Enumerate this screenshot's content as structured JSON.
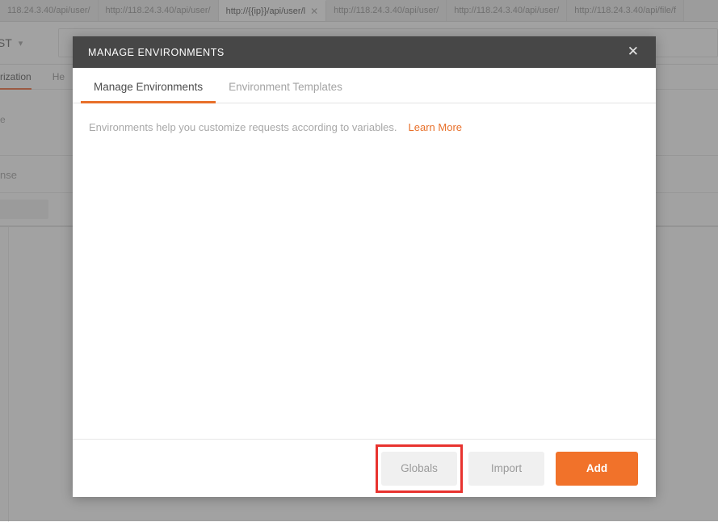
{
  "background": {
    "tabs": [
      {
        "label": "118.24.3.40/api/user/",
        "active": false,
        "closable": false
      },
      {
        "label": "http://118.24.3.40/api/user/",
        "active": false,
        "closable": false
      },
      {
        "label": "http://{{ip}}/api/user/l",
        "active": true,
        "closable": true,
        "close_icon": "close-icon"
      },
      {
        "label": "http://118.24.3.40/api/user/",
        "active": false,
        "closable": false
      },
      {
        "label": "http://118.24.3.40/api/user/",
        "active": false,
        "closable": false
      },
      {
        "label": "http://118.24.3.40/api/file/f",
        "active": false,
        "closable": false
      }
    ],
    "request": {
      "method": "OST",
      "method_caret_icon": "chevron-down-icon",
      "url_value": "",
      "url_placeholder": ""
    },
    "subtabs": [
      {
        "label": "rization",
        "selected": true
      },
      {
        "label": "He",
        "selected": false
      }
    ],
    "section_a_text": "e",
    "section_b_text": "nse"
  },
  "modal": {
    "title": "MANAGE ENVIRONMENTS",
    "close_icon": "close-icon",
    "tabs": [
      {
        "label": "Manage Environments",
        "active": true
      },
      {
        "label": "Environment Templates",
        "active": false
      }
    ],
    "body": {
      "description": "Environments help you customize requests according to variables.",
      "learn_more_label": "Learn More"
    },
    "footer": {
      "globals_label": "Globals",
      "import_label": "Import",
      "add_label": "Add"
    }
  },
  "colors": {
    "accent_orange": "#e8702a",
    "primary_button": "#f1722a",
    "header_dark": "#474747",
    "highlight_red": "#e8332f",
    "muted_text": "#a8a8a8"
  },
  "annotation": {
    "highlight_target": "Globals",
    "highlight_color": "#e8332f"
  }
}
